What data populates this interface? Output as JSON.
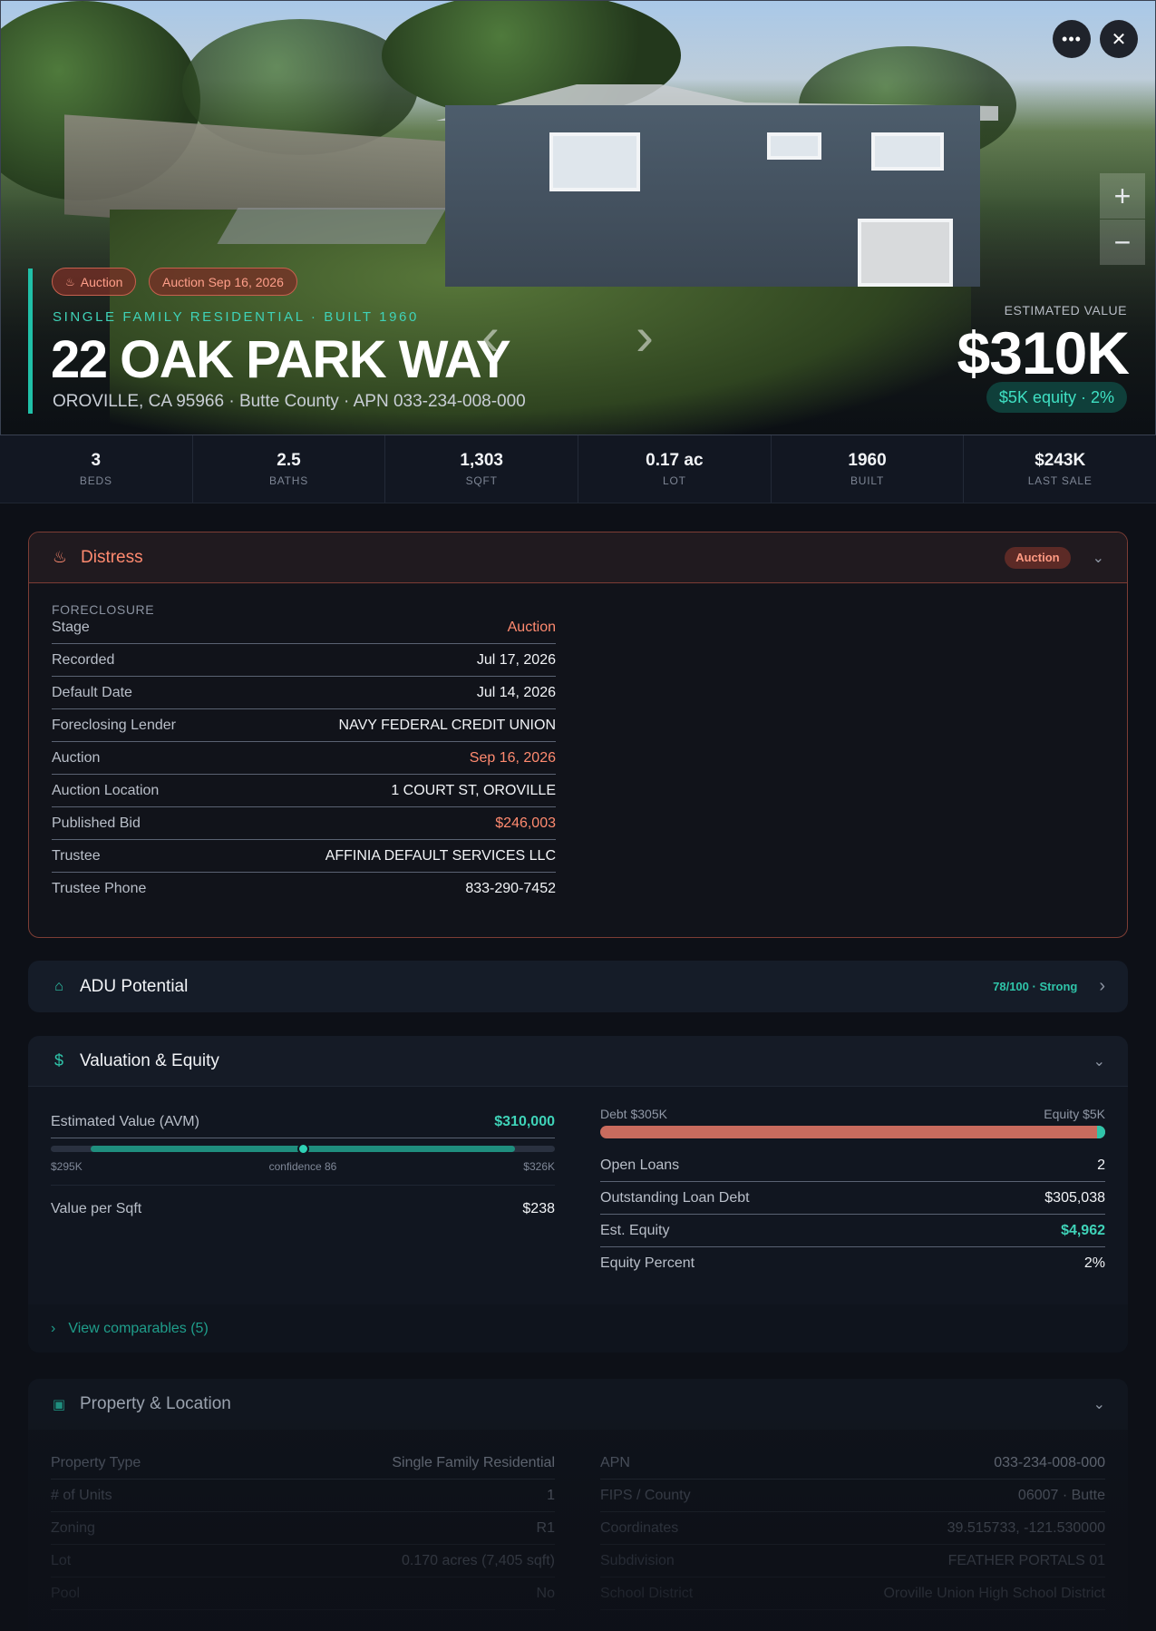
{
  "hero": {
    "pill_auction": "Auction",
    "pill_auction_date": "Auction Sep 16, 2026",
    "subtitle": "SINGLE FAMILY RESIDENTIAL · BUILT 1960",
    "address": "22 OAK PARK WAY",
    "location": "OROVILLE, CA 95966 · Butte County · APN 033-234-008-000",
    "est_label": "ESTIMATED VALUE",
    "est_value": "$310K",
    "equity_pill": "$5K equity · 2%",
    "more_icon": "more-icon",
    "close_icon": "close-icon",
    "zoom_in": "+",
    "zoom_out": "−"
  },
  "stats": [
    {
      "value": "3",
      "label": "BEDS"
    },
    {
      "value": "2.5",
      "label": "BATHS"
    },
    {
      "value": "1,303",
      "label": "SQFT"
    },
    {
      "value": "0.17 ac",
      "label": "LOT"
    },
    {
      "value": "1960",
      "label": "BUILT"
    },
    {
      "value": "$243K",
      "label": "LAST SALE"
    }
  ],
  "distress": {
    "title": "Distress",
    "badge": "Auction",
    "section_label": "FORECLOSURE",
    "rows": [
      {
        "k": "Stage",
        "v": "Auction"
      },
      {
        "k": "Recorded",
        "v": "Jul 17, 2026"
      },
      {
        "k": "Default Date",
        "v": "Jul 14, 2026"
      },
      {
        "k": "Foreclosing Lender",
        "v": "NAVY FEDERAL CREDIT UNION"
      },
      {
        "k": "Auction",
        "v": "Sep 16, 2026"
      },
      {
        "k": "Auction Location",
        "v": "1 COURT ST, OROVILLE"
      },
      {
        "k": "Published Bid",
        "v": "$246,003"
      },
      {
        "k": "Trustee",
        "v": "AFFINIA DEFAULT SERVICES LLC"
      },
      {
        "k": "Trustee Phone",
        "v": "833-290-7452"
      }
    ]
  },
  "adu": {
    "title": "ADU Potential",
    "score": "78/100 · Strong"
  },
  "valuation": {
    "title": "Valuation & Equity",
    "avm_label": "Estimated Value (AVM)",
    "avm_value": "$310,000",
    "range_low": "$295K",
    "range_high": "$326K",
    "confidence": "confidence 86",
    "range_fill": {
      "start": 0.08,
      "end": 0.92,
      "point": 0.5
    },
    "vps_label": "Value per Sqft",
    "vps_value": "$238",
    "debt_label": "Debt $305K",
    "equity_label": "Equity $5K",
    "equity_fraction": 0.016,
    "rows": [
      {
        "k": "Open Loans",
        "v": "2"
      },
      {
        "k": "Outstanding Loan Debt",
        "v": "$305,038"
      },
      {
        "k": "Est. Equity",
        "v": "$4,962"
      },
      {
        "k": "Equity Percent",
        "v": "2%"
      }
    ],
    "comps_link": "View comparables (5)"
  },
  "property": {
    "title": "Property & Location",
    "left_rows": [
      {
        "k": "Property Type",
        "v": "Single Family Residential"
      },
      {
        "k": "# of Units",
        "v": "1"
      },
      {
        "k": "Zoning",
        "v": "R1"
      },
      {
        "k": "Lot",
        "v": "0.170 acres (7,405 sqft)"
      },
      {
        "k": "Pool",
        "v": "No"
      }
    ],
    "right_rows": [
      {
        "k": "APN",
        "v": "033-234-008-000"
      },
      {
        "k": "FIPS / County",
        "v": "06007 · Butte"
      },
      {
        "k": "Coordinates",
        "v": "39.515733, -121.530000"
      },
      {
        "k": "Subdivision",
        "v": "FEATHER PORTALS 01"
      },
      {
        "k": "School District",
        "v": "Oroville Union High School District"
      }
    ]
  },
  "colors": {
    "accent_teal": "#20c0a8",
    "accent_red": "#ff8a6f",
    "debt": "#c96b5e",
    "background": "#0d1017"
  }
}
